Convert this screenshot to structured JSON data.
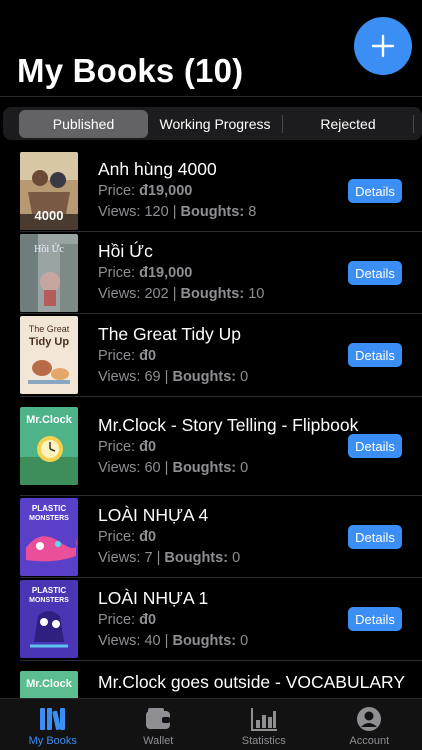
{
  "header": {
    "title": "My Books (10)"
  },
  "tabs": [
    "Published",
    "Working Progress",
    "Rejected"
  ],
  "books": [
    {
      "title": "Anh hùng 4000",
      "price": "đ19,000",
      "views": "120",
      "boughts": "8"
    },
    {
      "title": "Hồi Ức",
      "price": "đ19,000",
      "views": "202",
      "boughts": "10"
    },
    {
      "title": "The Great Tidy Up",
      "price": "đ0",
      "views": "69",
      "boughts": "0"
    },
    {
      "title": "Mr.Clock - Story Telling - Flipbook",
      "price": "đ0",
      "views": "60",
      "boughts": "0"
    },
    {
      "title": "LOÀI NHỰA 4",
      "price": "đ0",
      "views": "7",
      "boughts": "0"
    },
    {
      "title": "LOÀI NHỰA 1",
      "price": "đ0",
      "views": "40",
      "boughts": "0"
    },
    {
      "title": "Mr.Clock goes outside - VOCABULARY"
    }
  ],
  "labels": {
    "price": "Price:",
    "views": "Views:",
    "separator": "|",
    "boughts": "Boughts:",
    "details": "Details"
  },
  "covers": {
    "c1_text": "4000",
    "c2_text": "Hồi Ức",
    "c3_text1": "The Great",
    "c3_text2": "Tidy Up",
    "c4_text": "Mr.Clock",
    "c5_text1": "PLASTIC",
    "c5_text2": "MONSTERS"
  },
  "tabbar": [
    {
      "label": "My Books",
      "icon": "books-icon",
      "active": true
    },
    {
      "label": "Wallet",
      "icon": "wallet-icon"
    },
    {
      "label": "Statistics",
      "icon": "bar-chart-icon"
    },
    {
      "label": "Account",
      "icon": "person-circle-icon"
    }
  ],
  "colors": {
    "accent": "#3b8ef3",
    "background": "#000000",
    "secondary_text": "#8e8e93"
  }
}
